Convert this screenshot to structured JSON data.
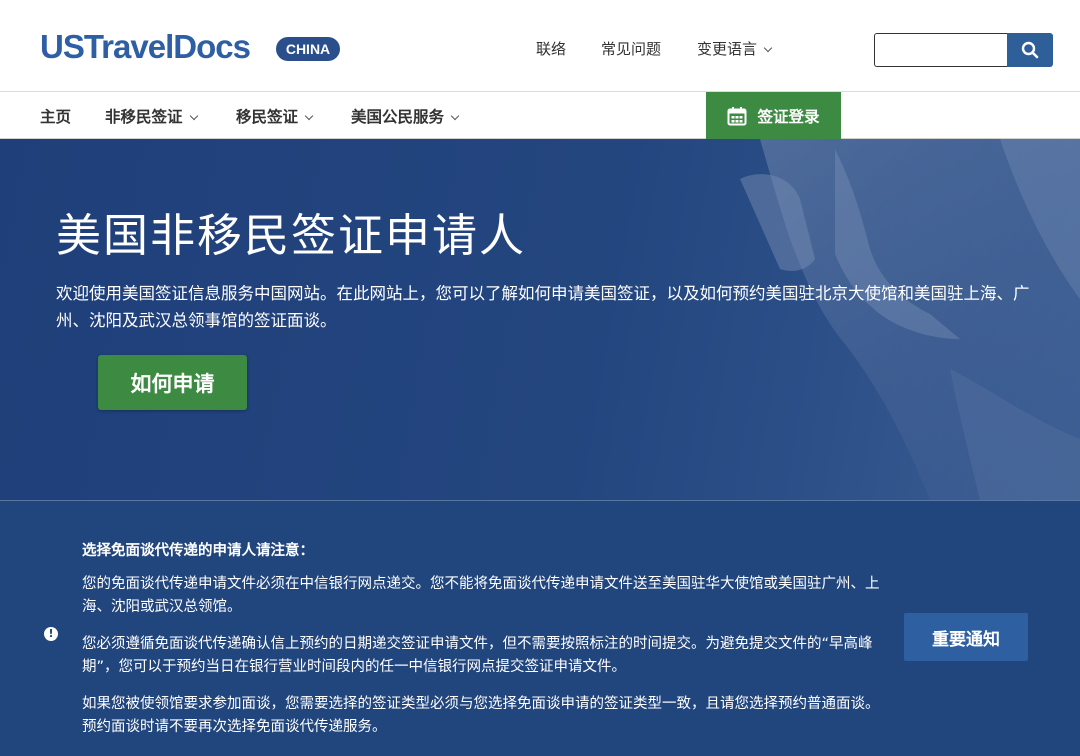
{
  "header": {
    "logo_text": "USTravelDocs",
    "logo_badge": "CHINA",
    "links": {
      "contact": "联络",
      "faq": "常见问题",
      "language": "变更语言"
    },
    "search": {
      "value": "",
      "placeholder": ""
    }
  },
  "nav": {
    "home": "主页",
    "nonimmigrant": "非移民签证",
    "immigrant": "移民签证",
    "citizen_services": "美国公民服务",
    "visa_login": "签证登录"
  },
  "hero": {
    "title": "美国非移民签证申请人",
    "text": "欢迎使用美国签证信息服务中国网站。在此网站上，您可以了解如何申请美国签证，以及如何预约美国驻北京大使馆和美国驻上海、广州、沈阳及武汉总领事馆的签证面谈。",
    "button": "如何申请"
  },
  "notice": {
    "icon_text": "!",
    "heading": "选择免面谈代传递的申请人请注意：",
    "paragraph1": "您的免面谈代传递申请文件必须在中信银行网点递交。您不能将免面谈代传递申请文件送至美国驻华大使馆或美国驻广州、上海、沈阳或武汉总领馆。",
    "paragraph2": "您必须遵循免面谈代传递确认信上预约的日期递交签证申请文件，但不需要按照标注的时间提交。为避免提交文件的“早高峰期”，您可以于预约当日在银行营业时间段内的任一中信银行网点提交签证申请文件。",
    "paragraph3": "如果您被使领馆要求参加面谈，您需要选择的签证类型必须与您选择免面谈申请的签证类型一致，且请您选择预约普通面谈。预约面谈时请不要再次选择免面谈代传递服务。",
    "button": "重要通知"
  },
  "colors": {
    "brand_blue": "#2e5ea3",
    "hero_blue": "#24467f",
    "notice_blue": "#21457d",
    "green": "#3d8a43"
  }
}
